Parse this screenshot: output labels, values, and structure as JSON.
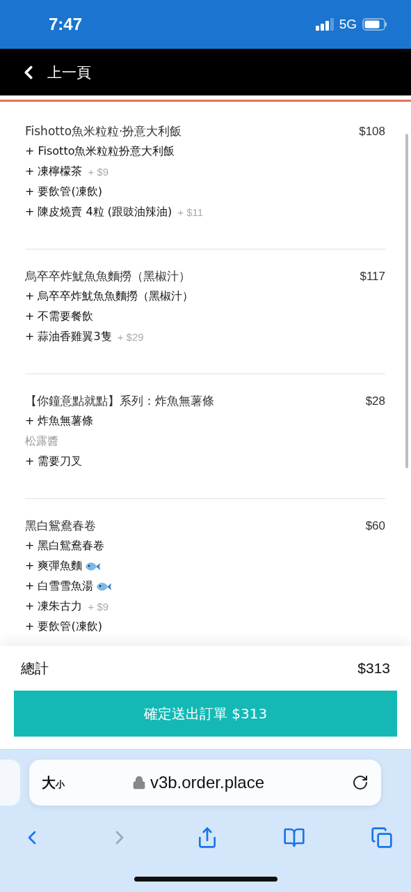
{
  "status_bar": {
    "time": "7:47",
    "network": "5G"
  },
  "nav": {
    "back_label": "上一頁"
  },
  "items": [
    {
      "name": "Fishotto魚米粒粒·扮意大利飯",
      "price": "$108",
      "options": [
        {
          "kind": "addon",
          "text": "+ Fisotto魚米粒粒扮意大利飯"
        },
        {
          "kind": "addon",
          "text": "+ 凍檸檬茶",
          "extra": "+ $9"
        },
        {
          "kind": "addon",
          "text": "+ 要飲管(凍飲)"
        },
        {
          "kind": "addon",
          "text": "+ 陳皮燒賣 4粒 (跟豉油辣油)",
          "extra": "+ $11"
        }
      ]
    },
    {
      "name": "烏卒卒炸魷魚魚麵撈（黑椒汁）",
      "price": "$117",
      "options": [
        {
          "kind": "addon",
          "text": "+ 烏卒卒炸魷魚魚麵撈（黑椒汁）"
        },
        {
          "kind": "addon",
          "text": "+ 不需要餐飲"
        },
        {
          "kind": "addon",
          "text": "+ 蒜油香雞翼3隻",
          "extra": "+ $29"
        }
      ]
    },
    {
      "name": "【你鐘意點就點】系列：炸魚無薯條",
      "price": "$28",
      "options": [
        {
          "kind": "addon",
          "text": "+ 炸魚無薯條"
        },
        {
          "kind": "note",
          "text": "松露醬"
        },
        {
          "kind": "addon",
          "text": "+ 需要刀叉"
        }
      ]
    },
    {
      "name": "黑白鴛鴦春卷",
      "price": "$60",
      "options": [
        {
          "kind": "addon",
          "text": "+ 黑白鴛鴦春卷"
        },
        {
          "kind": "addon",
          "text": "+ 爽彈魚麵",
          "fish": true
        },
        {
          "kind": "addon",
          "text": "+ 白雪雪魚湯",
          "fish": true
        },
        {
          "kind": "addon",
          "text": "+ 凍朱古力",
          "extra": "+ $9"
        },
        {
          "kind": "addon",
          "text": "+ 要飲管(凍飲)"
        }
      ]
    }
  ],
  "total": {
    "label": "總計",
    "amount": "$313"
  },
  "submit_button": "確定送出訂單 $313",
  "browser": {
    "text_size_big": "大",
    "text_size_small": "小",
    "url": "v3b.order.place"
  }
}
